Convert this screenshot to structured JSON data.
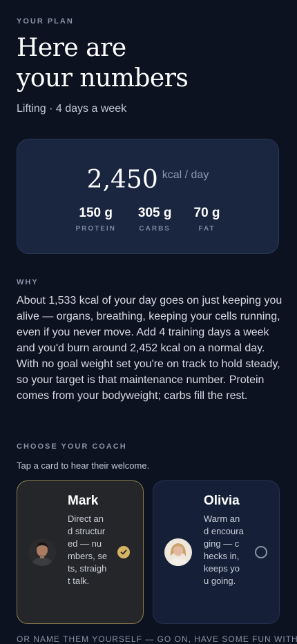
{
  "header": {
    "eyebrow": "YOUR PLAN",
    "title_line1": "Here are",
    "title_line2": "your numbers",
    "subtitle": "Lifting · 4 days a week"
  },
  "summary": {
    "kcal": "2,450",
    "kcal_unit": "kcal / day",
    "macros": [
      {
        "value": "150 g",
        "label": "PROTEIN"
      },
      {
        "value": "305 g",
        "label": "CARBS"
      },
      {
        "value": "70 g",
        "label": "FAT"
      }
    ]
  },
  "why": {
    "eyebrow": "WHY",
    "text": "About 1,533 kcal of your day goes on just keeping you alive — organs, breathing, keeping your cells running, even if you never move. Add 4 training days a week and you'd burn around 2,452 kcal on a normal day. With no goal weight set you're on track to hold steady, so your target is that maintenance number. Protein comes from your bodyweight; carbs fill the rest."
  },
  "coach": {
    "eyebrow": "CHOOSE YOUR COACH",
    "hint": "Tap a card to hear their welcome.",
    "cards": [
      {
        "name": "Mark",
        "description": "Direct and structured — numbers, sets, straight talk.",
        "selected": true,
        "icon": "check-icon"
      },
      {
        "name": "Olivia",
        "description": "Warm and encouraging — checks in, keeps you going.",
        "selected": false,
        "icon": "radio-empty-icon"
      }
    ],
    "rename_prompt": "OR NAME THEM YOURSELF — GO ON, HAVE SOME FUN WITH"
  },
  "colors": {
    "background": "#0c1220",
    "card": "#1a2540",
    "accent_gold": "#d6b364"
  }
}
